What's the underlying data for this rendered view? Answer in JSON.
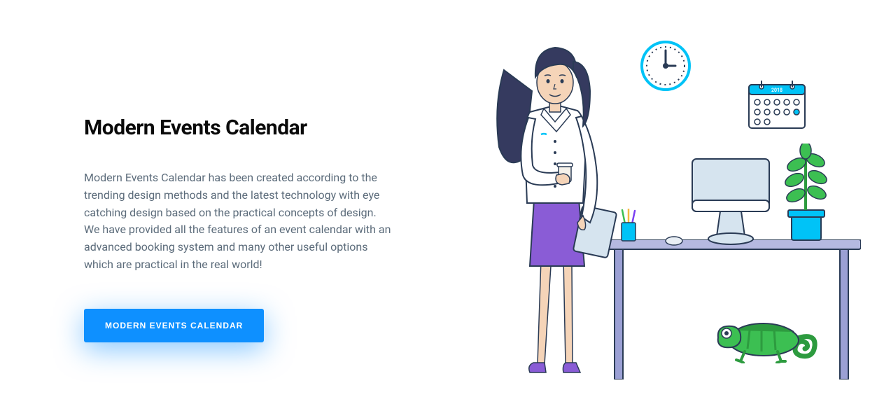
{
  "hero": {
    "heading": "Modern Events Calendar",
    "description": "Modern Events Calendar has been created according to the trending design methods and the latest technology with eye catching design based on the practical concepts of design. We have provided all the features of an event calendar with an advanced booking system and many other useful options which are practical in the real world!",
    "cta_label": "MODERN EVENTS CALENDAR"
  },
  "illustration": {
    "calendar_year": "2018"
  }
}
